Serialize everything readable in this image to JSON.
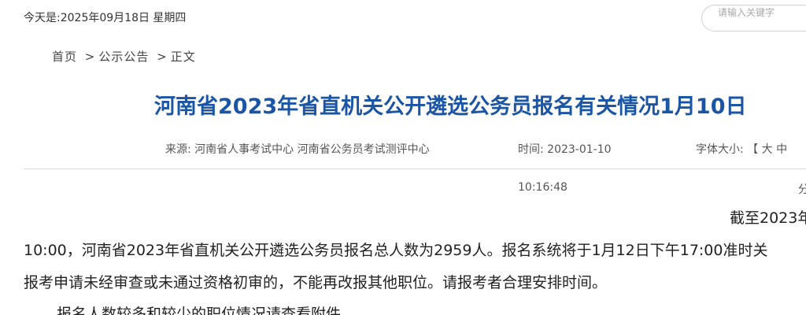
{
  "header": {
    "date_text": "今天是:2025年09月18日 星期四",
    "search_placeholder": "请输入关键字"
  },
  "breadcrumb": {
    "home": "首页",
    "sep1": ">",
    "section": "公示公告",
    "sep2": ">",
    "current": "正文"
  },
  "article": {
    "title": "河南省2023年省直机关公开遴选公务员报名有关情况1月10日",
    "source_label": "来源:",
    "source_value": "河南省人事考试中心 河南省公务员考试测评中心",
    "time_label": "时间:",
    "time_date": "2023-01-10",
    "time_clock": "10:16:48",
    "font_size_label": "字体大小:",
    "font_size_bracket": "【",
    "font_size_large": "大",
    "font_size_medium": "中",
    "share_partial": "分",
    "paragraphs": [
      "截至2023年",
      "10:00，河南省2023年省直机关公开遴选公务员报名总人数为2959人。报名系统将于1月12日下午17:00准时关",
      "报考申请未经审查或未通过资格初审的，不能再改报其他职位。请报考者合理安排时间。",
      "报名人数较多和较少的职位情况请查看附件。"
    ]
  }
}
